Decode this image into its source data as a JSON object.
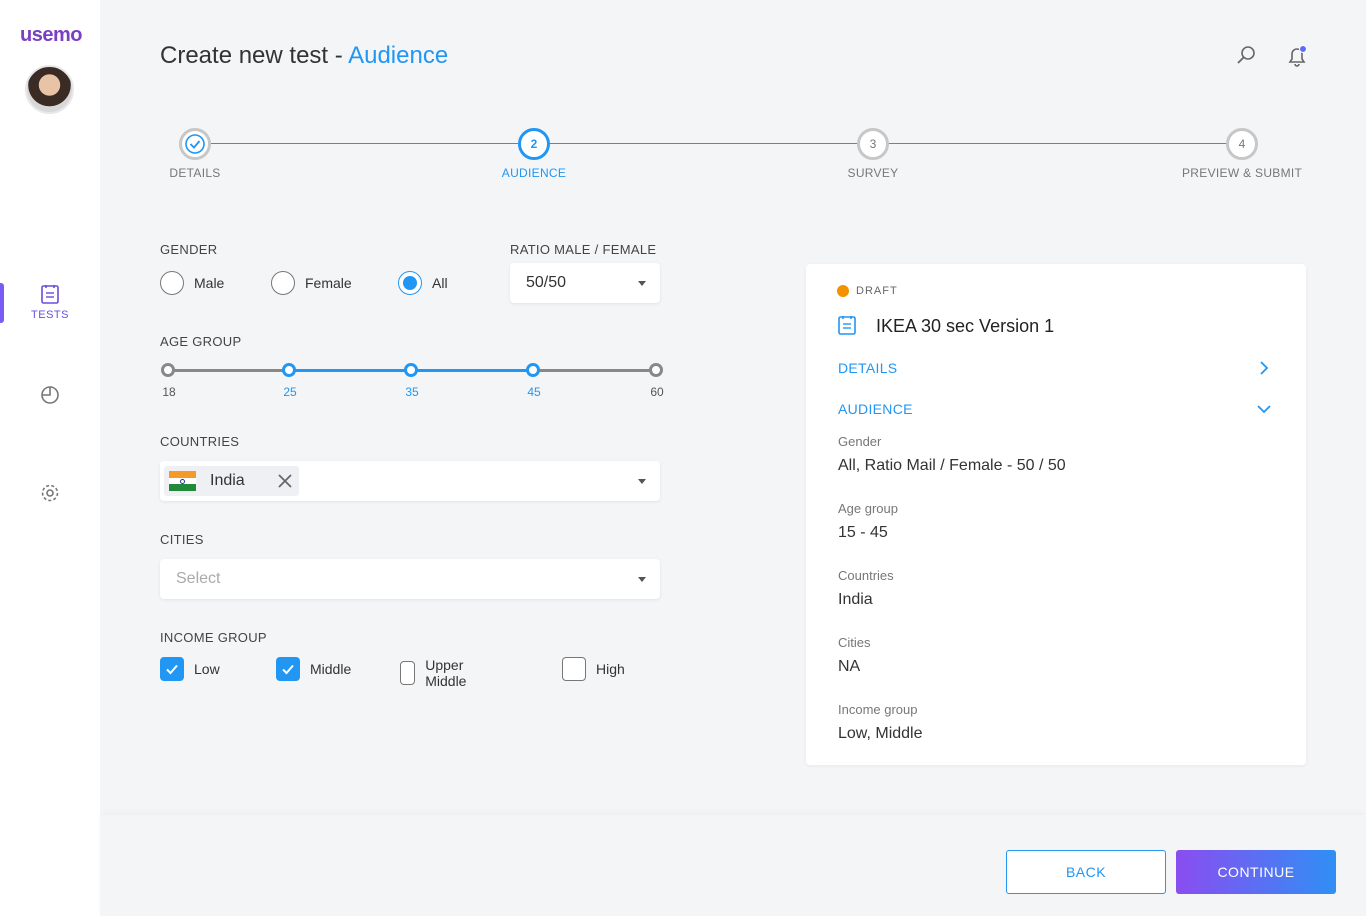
{
  "app": {
    "logo": "usemo"
  },
  "nav": {
    "tests_label": "TESTS"
  },
  "header": {
    "title_prefix": "Create new test - ",
    "title_accent": "Audience"
  },
  "stepper": {
    "steps": [
      {
        "num": "1",
        "label": "DETAILS",
        "state": "done"
      },
      {
        "num": "2",
        "label": "AUDIENCE",
        "state": "active"
      },
      {
        "num": "3",
        "label": "SURVEY",
        "state": "pending"
      },
      {
        "num": "4",
        "label": "PREVIEW & SUBMIT",
        "state": "pending"
      }
    ]
  },
  "form": {
    "gender_label": "GENDER",
    "gender_options": [
      "Male",
      "Female",
      "All"
    ],
    "gender_selected": "All",
    "ratio_label": "RATIO MALE / FEMALE",
    "ratio_value": "50/50",
    "age_label": "AGE GROUP",
    "age_ticks": [
      "18",
      "25",
      "35",
      "45",
      "60"
    ],
    "age_range": [
      25,
      45
    ],
    "countries_label": "COUNTRIES",
    "country_chip": "India",
    "cities_label": "CITIES",
    "cities_placeholder": "Select",
    "income_label": "INCOME GROUP",
    "income_options": [
      {
        "label": "Low",
        "checked": true
      },
      {
        "label": "Middle",
        "checked": true
      },
      {
        "label": "Upper Middle",
        "checked": false
      },
      {
        "label": "High",
        "checked": false
      }
    ]
  },
  "summary": {
    "status": "DRAFT",
    "title": "IKEA 30 sec Version 1",
    "details_head": "DETAILS",
    "audience_head": "AUDIENCE",
    "items": [
      {
        "key": "Gender",
        "value": "All, Ratio Mail / Female - 50 / 50"
      },
      {
        "key": "Age group",
        "value": "15 - 45"
      },
      {
        "key": "Countries",
        "value": "India"
      },
      {
        "key": "Cities",
        "value": "NA"
      },
      {
        "key": "Income group",
        "value": "Low, Middle"
      }
    ]
  },
  "footer": {
    "back_label": "BACK",
    "continue_label": "CONTINUE"
  },
  "colors": {
    "accent": "#2196f3",
    "brand": "#7b3fc4",
    "draft": "#f39200"
  }
}
